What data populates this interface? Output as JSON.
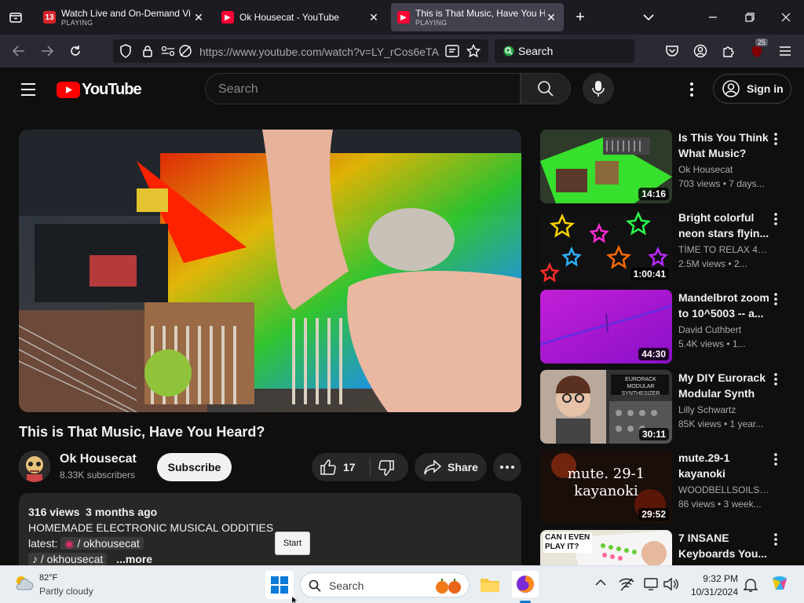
{
  "browser": {
    "tabs": [
      {
        "title": "Watch Live and On-Demand Vi",
        "status": "PLAYING",
        "favicon": "13"
      },
      {
        "title": "Ok Housecat - YouTube",
        "status": ""
      },
      {
        "title": "This is That Music, Have You H",
        "status": "PLAYING"
      }
    ],
    "url": "https://www.youtube.com/watch?v=LY_rCos6eTA",
    "search_placeholder": "Search",
    "extension_badge": "25"
  },
  "youtube": {
    "logo_text": "YouTube",
    "search_placeholder": "Search",
    "sign_in": "Sign in",
    "video": {
      "title": "This is That Music, Have You Heard?",
      "channel": "Ok Housecat",
      "subscribers": "8.33K subscribers",
      "subscribe_label": "Subscribe",
      "likes": "17",
      "share_label": "Share",
      "views": "316 views",
      "age": "3 months ago",
      "description_line1": "HOMEMADE ELECTRONIC MUSICAL ODDITIES",
      "latest_label": "latest:",
      "instagram_handle": "/ okhousecat",
      "tiktok_handle": "/ okhousecat",
      "more_label": "...more"
    },
    "recommendations": [
      {
        "title": "Is This You Think What Music?",
        "channel": "Ok Housecat",
        "meta": "703 views • 7 days...",
        "duration": "14:16"
      },
      {
        "title": "Bright colorful neon stars flyin...",
        "channel": "TİME TO RELAX 4K...",
        "meta": "2.5M views • 2...",
        "duration": "1:00:41"
      },
      {
        "title": "Mandelbrot zoom to 10^5003 -- a...",
        "channel": "David Cuthbert",
        "meta": "5.4K views • 1...",
        "duration": "44:30"
      },
      {
        "title": "My DIY Eurorack Modular Synth",
        "channel": "Lilly Schwartz",
        "meta": "85K views • 1 year...",
        "duration": "30:11",
        "thumb_text": "EURORACK MODULAR SYNTHESIZER"
      },
      {
        "title": "mute.29-1 kayanoki",
        "channel": "WOODBELLSOILSH...",
        "meta": "86 views • 3 week...",
        "duration": "29:52",
        "thumb_text": "mute. 29-1 kayanoki"
      },
      {
        "title": "7 INSANE Keyboards You...",
        "channel": "",
        "meta": "",
        "duration": "",
        "thumb_text": "CAN I EVEN PLAY IT?"
      }
    ]
  },
  "tooltip": "Start",
  "taskbar": {
    "weather_temp": "82°F",
    "weather_desc": "Partly cloudy",
    "search_placeholder": "Search",
    "time": "9:32 PM",
    "date": "10/31/2024"
  }
}
